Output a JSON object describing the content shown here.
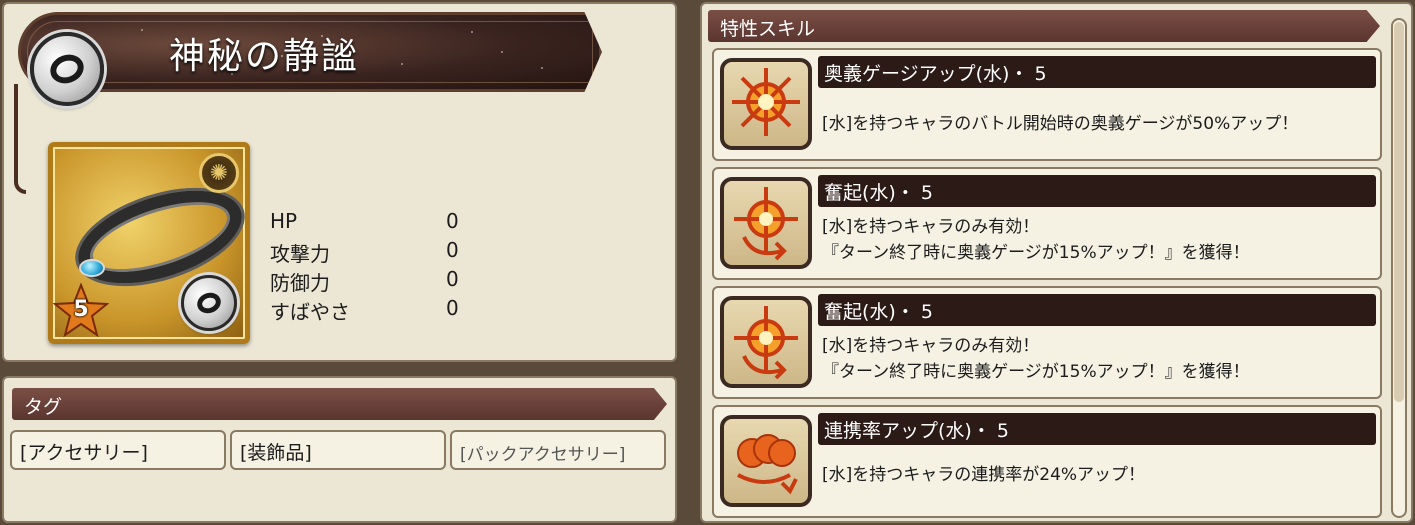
{
  "item": {
    "name": "神秘の静謐",
    "rarity_stars": "5",
    "element_icon": "ring-icon",
    "stats": [
      {
        "label": "HP",
        "value": "0"
      },
      {
        "label": "攻撃力",
        "value": "0"
      },
      {
        "label": "防御力",
        "value": "0"
      },
      {
        "label": "すばやさ",
        "value": "0"
      }
    ]
  },
  "tags": {
    "header": "タグ",
    "items": [
      "[アクセサリー]",
      "[装飾品]",
      "[パックアクセサリー]"
    ]
  },
  "skills": {
    "header": "特性スキル",
    "items": [
      {
        "name": "奥義ゲージアップ(水)・ 5",
        "icon": "sun-gauge-icon",
        "desc": [
          "[水]を持つキャラのバトル開始時の奥義ゲージが50%アップ！"
        ]
      },
      {
        "name": "奮起(水)・ 5",
        "icon": "sun-arrow-icon",
        "desc": [
          "[水]を持つキャラのみ有効！",
          "『ターン終了時に奥義ゲージが15%アップ！』を獲得！"
        ]
      },
      {
        "name": "奮起(水)・ 5",
        "icon": "sun-arrow-icon",
        "desc": [
          "[水]を持つキャラのみ有効！",
          "『ターン終了時に奥義ゲージが15%アップ！』を獲得！"
        ]
      },
      {
        "name": "連携率アップ(水)・ 5",
        "icon": "chain-attack-icon",
        "desc": [
          "[水]を持つキャラの連携率が24%アップ！"
        ]
      }
    ]
  },
  "colors": {
    "header_brown": "#6a4239",
    "panel_bg": "#ece7d5",
    "skill_icon_orange": "#e8641e"
  }
}
